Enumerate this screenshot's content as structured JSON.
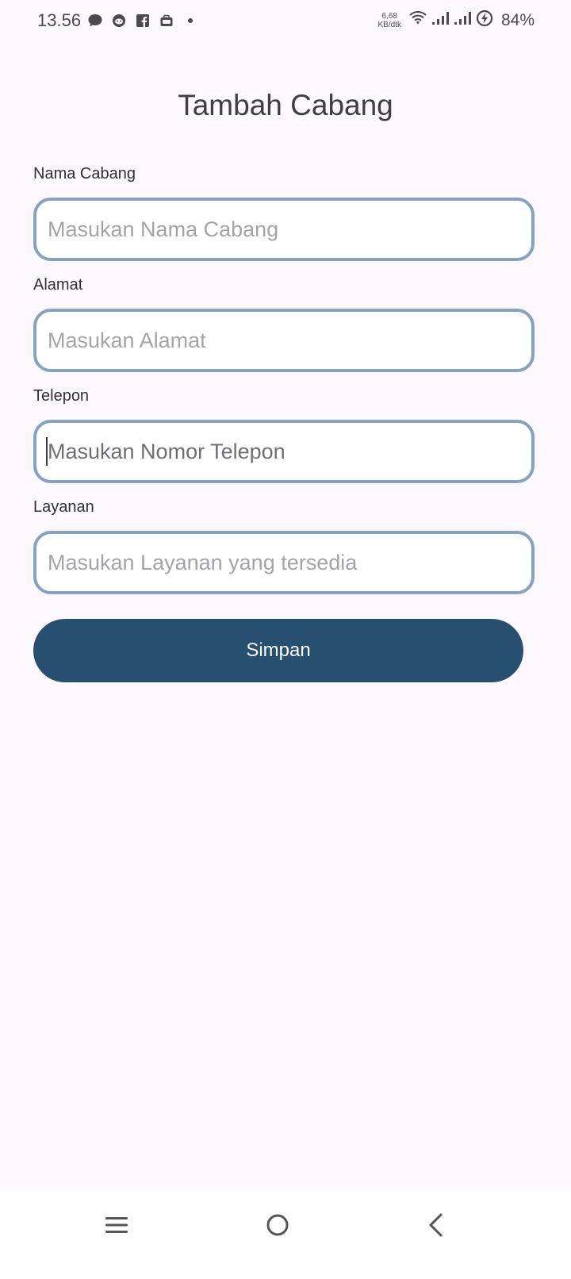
{
  "status_bar": {
    "time": "13.56",
    "net_speed_value": "6,68",
    "net_speed_unit": "KB/dtk",
    "battery": "84%",
    "notification_icons": [
      "chat-bubble-icon",
      "reddit-icon",
      "facebook-icon",
      "briefcase-icon",
      "dot-icon"
    ],
    "system_icons": [
      "wifi-icon",
      "signal-icon",
      "signal-icon",
      "charging-icon"
    ]
  },
  "page": {
    "title": "Tambah Cabang"
  },
  "form": {
    "fields": [
      {
        "label": "Nama Cabang",
        "placeholder": "Masukan Nama Cabang",
        "value": ""
      },
      {
        "label": "Alamat",
        "placeholder": "Masukan Alamat",
        "value": ""
      },
      {
        "label": "Telepon",
        "placeholder": "Masukan Nomor Telepon",
        "value": ""
      },
      {
        "label": "Layanan",
        "placeholder": "Masukan Layanan yang tersedia",
        "value": ""
      }
    ],
    "submit_label": "Simpan"
  },
  "nav_bar": {
    "icons": [
      "menu-icon",
      "home-icon",
      "back-icon"
    ]
  },
  "colors": {
    "background": "#fdf7fe",
    "input_border": "#85a2c2",
    "button": "#264f70",
    "button_text": "#ffffff"
  }
}
